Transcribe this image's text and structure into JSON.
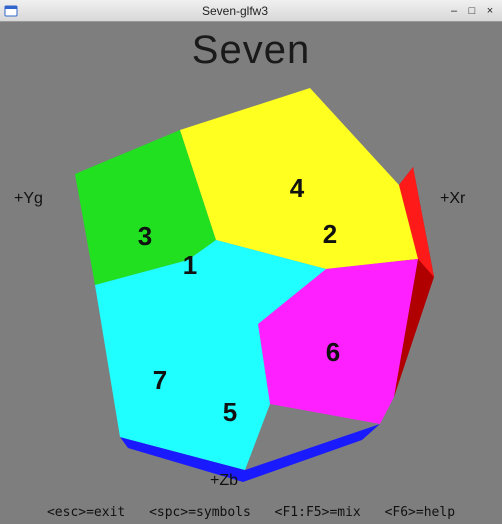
{
  "window": {
    "title": "Seven-glfw3",
    "icon_name": "app-icon",
    "controls": {
      "minimize": "–",
      "maximize": "□",
      "close": "×"
    }
  },
  "app": {
    "title": "Seven"
  },
  "axes": {
    "yg": "+Yg",
    "xr": "+Xr",
    "zb": "+Zb"
  },
  "faces": {
    "f1": "1",
    "f2": "2",
    "f3": "3",
    "f4": "4",
    "f5": "5",
    "f6": "6",
    "f7": "7"
  },
  "colors": {
    "green": "#20e020",
    "yellow": "#ffff20",
    "red": "#ff1a1a",
    "magenta": "#ff20ff",
    "cyan": "#20ffff",
    "blue": "#1a1aff",
    "darkred": "#b00000"
  },
  "hints": {
    "h1": "<esc>=exit",
    "h2": "<spc>=symbols",
    "h3": "<F1:F5>=mix",
    "h4": "<F6>=help"
  }
}
